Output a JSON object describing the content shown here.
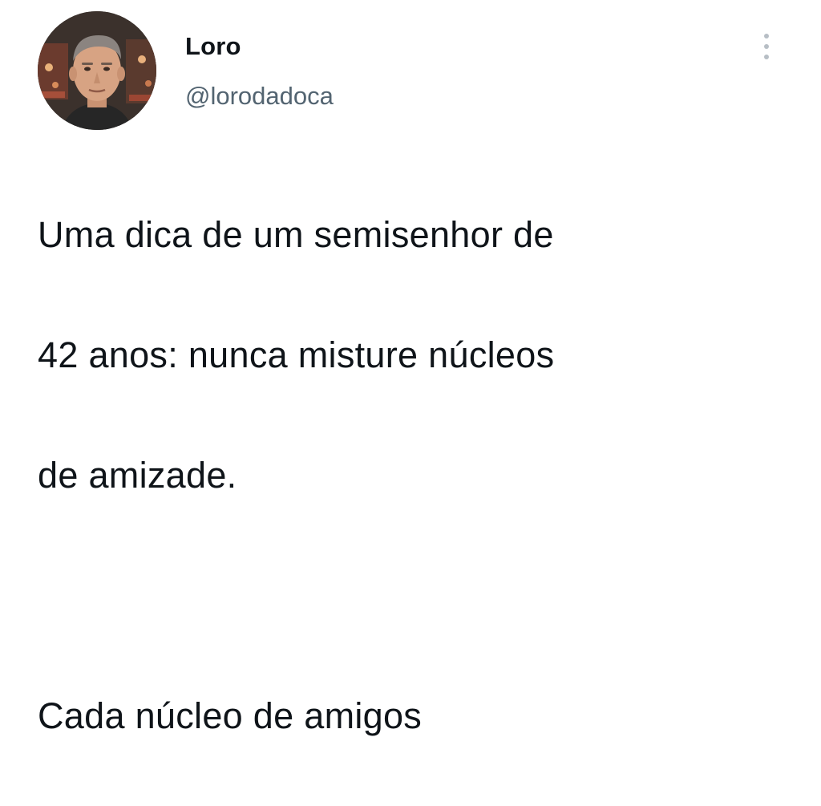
{
  "tweet": {
    "author": {
      "display_name": "Loro",
      "handle": "@lorodadoca",
      "avatar_icon": "profile-photo"
    },
    "menu_icon": "more-vertical-icon",
    "text_lines": [
      "Uma dica de um semisenhor de",
      "42 anos: nunca misture núcleos",
      "de amizade.",
      "",
      "Cada núcleo de amigos"
    ]
  },
  "colors": {
    "text_primary": "#0f1419",
    "text_secondary": "#536471",
    "background": "#ffffff"
  }
}
